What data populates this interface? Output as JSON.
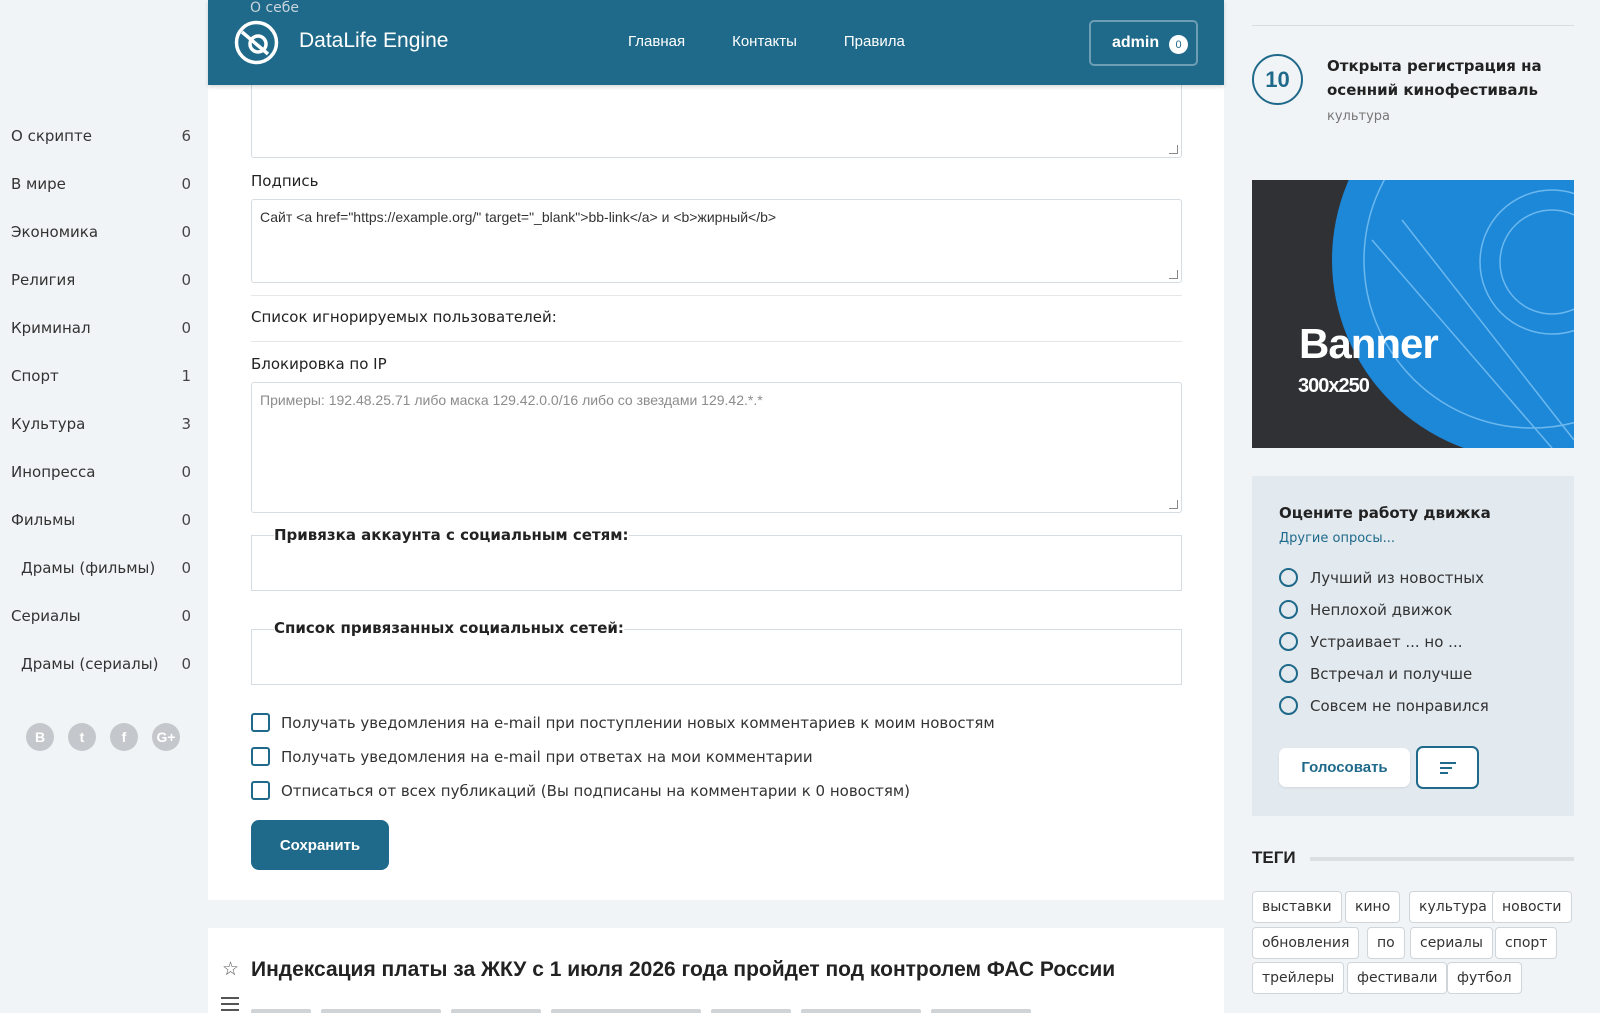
{
  "header": {
    "brand": "DataLife Engine",
    "nav": [
      "Главная",
      "Контакты",
      "Правила"
    ],
    "user": "admin",
    "notifications": "0",
    "ghost_label": "О себе"
  },
  "sidebar": {
    "items": [
      {
        "label": "О скрипте",
        "count": "6",
        "sub": false
      },
      {
        "label": "В мире",
        "count": "0",
        "sub": false
      },
      {
        "label": "Экономика",
        "count": "0",
        "sub": false
      },
      {
        "label": "Религия",
        "count": "0",
        "sub": false
      },
      {
        "label": "Криминал",
        "count": "0",
        "sub": false
      },
      {
        "label": "Спорт",
        "count": "1",
        "sub": false
      },
      {
        "label": "Культура",
        "count": "3",
        "sub": false
      },
      {
        "label": "Инопресса",
        "count": "0",
        "sub": false
      },
      {
        "label": "Фильмы",
        "count": "0",
        "sub": false
      },
      {
        "label": "Драмы (фильмы)",
        "count": "0",
        "sub": true
      },
      {
        "label": "Сериалы",
        "count": "0",
        "sub": false
      },
      {
        "label": "Драмы (сериалы)",
        "count": "0",
        "sub": true
      }
    ],
    "social": [
      {
        "icon": "vk-icon",
        "glyph": "B"
      },
      {
        "icon": "twitter-icon",
        "glyph": "t"
      },
      {
        "icon": "facebook-icon",
        "glyph": "f"
      },
      {
        "icon": "google-plus-icon",
        "glyph": "G+"
      }
    ]
  },
  "form": {
    "signature_label": "Подпись",
    "signature_value": "Сайт <a href=\"https://example.org/\" target=\"_blank\">bb-link</a> и <b>жирный</b>",
    "ignore_label": "Список игнорируемых пользователей:",
    "ip_label": "Блокировка по IP",
    "ip_placeholder": "Примеры: 192.48.25.71 либо маска 129.42.0.0/16 либо со звездами 129.42.*.*",
    "social_bind_legend": "Привязка аккаунта с социальным сетям:",
    "social_list_legend": "Список привязанных социальных сетей:",
    "checkboxes": [
      "Получать уведомления на e-mail при поступлении новых комментариев к моим новостям",
      "Получать уведомления на e-mail при ответах на мои комментарии",
      "Отписаться от всех публикаций (Вы подписаны на комментарии к 0 новостям)"
    ],
    "save_label": "Сохранить"
  },
  "news": {
    "title": "Индексация платы за ЖКУ с 1 июля 2026 года пройдет под контролем ФАС России"
  },
  "right": {
    "top_news": {
      "rank": "10",
      "title": "Открыта регистрация на осенний кинофестиваль",
      "category": "культура"
    },
    "banner": {
      "title": "Banner",
      "size": "300x250"
    },
    "poll": {
      "title": "Оцените работу движка",
      "other_link": "Другие опросы...",
      "options": [
        "Лучший из новостных",
        "Неплохой движок",
        "Устраивает ... но ...",
        "Встречал и получше",
        "Совсем не понравился"
      ],
      "vote_label": "Голосовать"
    },
    "tags_title": "ТЕГИ",
    "tags": [
      "выставки",
      "кино",
      "культура",
      "новости",
      "обновления",
      "по",
      "сериалы",
      "спорт",
      "трейлеры",
      "фестивали",
      "футбол"
    ]
  },
  "colors": {
    "accent": "#1f6a8a",
    "banner_blue": "#1e88d8",
    "banner_dark": "#2f3135"
  }
}
